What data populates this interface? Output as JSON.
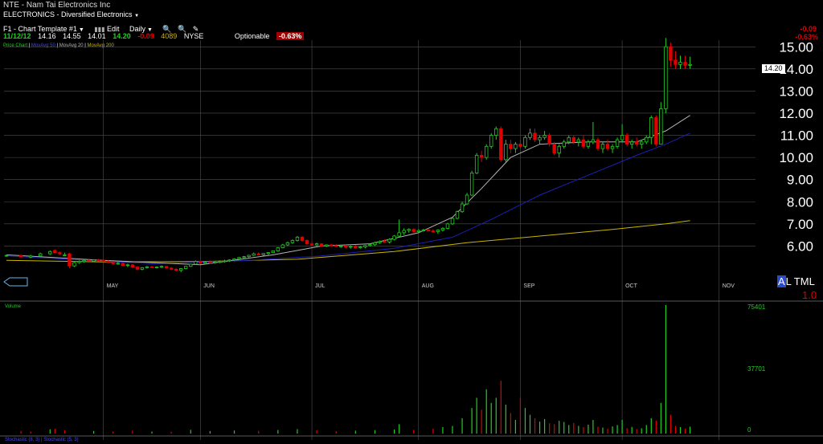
{
  "header": {
    "ticker": "NTE",
    "separator": "-",
    "name": "Nam Tai Electronics Inc",
    "sector": "ELECTRONICS - Diversified Electronics"
  },
  "toolbar": {
    "template": "F1 - Chart Template #1",
    "edit": "Edit",
    "period": "Daily"
  },
  "quote": {
    "date": "11/12/12",
    "open": "14.16",
    "high": "14.55",
    "low": "14.01",
    "last": "14.20",
    "change": "-0.09",
    "volume": "4089",
    "exchange": "NYSE",
    "optionable": "Optionable",
    "change_pct": "-0.63%"
  },
  "legend": {
    "price_chart": "Price Chart",
    "ma1": "MovAvg 50",
    "ma2": "MovAvg 20",
    "ma3": "MovAvg 200"
  },
  "corner": {
    "change": "-0.09",
    "change_pct": "-0.63%",
    "price_tag": "14.20",
    "mode_letter": "A",
    "mode_rest": "L TML",
    "scale": "1.0"
  },
  "volume_panel": {
    "label": "Volume",
    "max_label": "75401",
    "mid_label": "37701",
    "zero_label": "0"
  },
  "stoch_label": "Stochastic (8, 3) | Stochastic (5, 3)",
  "colors": {
    "up": "#22cc22",
    "down": "#e00000",
    "ma50": "#1e1eb4",
    "ma20": "#b4b4b4",
    "ma200": "#c8b400",
    "grid": "#505050",
    "volume_up": "#22cc22",
    "volume_down": "#e00000"
  },
  "chart_data": {
    "type": "candlestick",
    "y_ticks": [
      "6.00",
      "7.00",
      "8.00",
      "9.00",
      "10.00",
      "11.00",
      "12.00",
      "13.00",
      "14.00",
      "15.00"
    ],
    "ylim": [
      4.6,
      15.3
    ],
    "month_labels": [
      "MAY",
      "JUN",
      "JUL",
      "AUG",
      "SEP",
      "OCT",
      "NOV"
    ],
    "month_positions": [
      20,
      40,
      63,
      85,
      106,
      127,
      147
    ],
    "n_days": 155,
    "candles": [
      [
        0,
        5.55,
        5.6,
        5.5,
        5.58
      ],
      [
        3,
        5.58,
        5.62,
        5.5,
        5.5
      ],
      [
        5,
        5.5,
        5.6,
        5.45,
        5.55
      ],
      [
        7,
        5.55,
        5.7,
        5.5,
        5.65
      ],
      [
        9,
        5.65,
        5.8,
        5.6,
        5.75
      ],
      [
        10,
        5.8,
        5.85,
        5.7,
        5.7
      ],
      [
        11,
        5.7,
        5.75,
        5.6,
        5.65
      ],
      [
        12,
        5.6,
        5.7,
        5.55,
        5.6
      ],
      [
        13,
        5.65,
        5.7,
        5.0,
        5.1
      ],
      [
        14,
        5.1,
        5.3,
        5.05,
        5.25
      ],
      [
        15,
        5.25,
        5.35,
        5.2,
        5.3
      ],
      [
        16,
        5.3,
        5.4,
        5.25,
        5.35
      ],
      [
        17,
        5.35,
        5.4,
        5.3,
        5.32
      ],
      [
        18,
        5.32,
        5.4,
        5.28,
        5.38
      ],
      [
        19,
        5.38,
        5.42,
        5.3,
        5.35
      ],
      [
        20,
        5.35,
        5.4,
        5.28,
        5.3
      ],
      [
        21,
        5.3,
        5.36,
        5.22,
        5.25
      ],
      [
        22,
        5.25,
        5.3,
        5.18,
        5.2
      ],
      [
        23,
        5.2,
        5.28,
        5.15,
        5.22
      ],
      [
        24,
        5.22,
        5.25,
        5.1,
        5.12
      ],
      [
        25,
        5.12,
        5.2,
        5.05,
        5.15
      ],
      [
        26,
        5.15,
        5.18,
        5.0,
        5.05
      ],
      [
        27,
        5.05,
        5.1,
        4.9,
        4.95
      ],
      [
        28,
        4.95,
        5.05,
        4.9,
        5.02
      ],
      [
        29,
        5.02,
        5.1,
        4.98,
        5.06
      ],
      [
        30,
        5.06,
        5.1,
        5.0,
        5.03
      ],
      [
        31,
        5.03,
        5.08,
        4.98,
        5.05
      ],
      [
        32,
        5.05,
        5.12,
        5.0,
        5.08
      ],
      [
        33,
        5.08,
        5.1,
        4.98,
        5.0
      ],
      [
        34,
        5.0,
        5.05,
        4.9,
        4.95
      ],
      [
        35,
        4.95,
        5.0,
        4.85,
        4.9
      ],
      [
        36,
        4.9,
        5.0,
        4.82,
        4.98
      ],
      [
        37,
        4.98,
        5.1,
        4.95,
        5.08
      ],
      [
        38,
        5.08,
        5.2,
        5.05,
        5.18
      ],
      [
        39,
        5.18,
        5.35,
        5.15,
        5.3
      ],
      [
        40,
        5.3,
        5.35,
        5.2,
        5.22
      ],
      [
        41,
        5.22,
        5.3,
        5.18,
        5.27
      ],
      [
        42,
        5.27,
        5.35,
        5.2,
        5.25
      ],
      [
        43,
        5.25,
        5.32,
        5.2,
        5.28
      ],
      [
        44,
        5.28,
        5.35,
        5.22,
        5.3
      ],
      [
        45,
        5.3,
        5.38,
        5.25,
        5.33
      ],
      [
        46,
        5.33,
        5.4,
        5.28,
        5.37
      ],
      [
        47,
        5.37,
        5.45,
        5.32,
        5.42
      ],
      [
        48,
        5.42,
        5.5,
        5.38,
        5.48
      ],
      [
        49,
        5.48,
        5.55,
        5.42,
        5.52
      ],
      [
        50,
        5.52,
        5.6,
        5.48,
        5.58
      ],
      [
        51,
        5.58,
        5.7,
        5.55,
        5.65
      ],
      [
        52,
        5.65,
        5.72,
        5.58,
        5.6
      ],
      [
        53,
        5.6,
        5.68,
        5.55,
        5.66
      ],
      [
        54,
        5.66,
        5.72,
        5.6,
        5.7
      ],
      [
        55,
        5.7,
        5.8,
        5.68,
        5.78
      ],
      [
        56,
        5.78,
        5.95,
        5.75,
        5.92
      ],
      [
        57,
        5.92,
        6.1,
        5.9,
        6.05
      ],
      [
        58,
        6.05,
        6.2,
        6.0,
        6.15
      ],
      [
        59,
        6.15,
        6.3,
        6.1,
        6.25
      ],
      [
        60,
        6.25,
        6.45,
        6.2,
        6.4
      ],
      [
        61,
        6.4,
        6.45,
        6.2,
        6.25
      ],
      [
        62,
        6.25,
        6.3,
        6.05,
        6.1
      ],
      [
        63,
        6.1,
        6.2,
        6.0,
        6.05
      ],
      [
        64,
        6.05,
        6.15,
        6.0,
        6.1
      ],
      [
        65,
        6.1,
        6.12,
        5.98,
        6.0
      ],
      [
        66,
        6.0,
        6.08,
        5.95,
        6.05
      ],
      [
        67,
        6.05,
        6.1,
        5.98,
        6.02
      ],
      [
        68,
        6.02,
        6.08,
        5.95,
        5.98
      ],
      [
        69,
        5.98,
        6.05,
        5.92,
        6.0
      ],
      [
        70,
        6.0,
        6.05,
        5.9,
        5.95
      ],
      [
        71,
        5.95,
        6.02,
        5.88,
        5.98
      ],
      [
        72,
        5.98,
        6.05,
        5.9,
        5.92
      ],
      [
        73,
        5.92,
        6.0,
        5.88,
        5.96
      ],
      [
        74,
        5.96,
        6.05,
        5.9,
        6.02
      ],
      [
        75,
        6.02,
        6.1,
        5.98,
        6.06
      ],
      [
        76,
        6.06,
        6.2,
        6.0,
        6.15
      ],
      [
        77,
        6.15,
        6.25,
        6.1,
        6.2
      ],
      [
        78,
        6.2,
        6.3,
        6.15,
        6.18
      ],
      [
        79,
        6.18,
        6.35,
        6.12,
        6.3
      ],
      [
        80,
        6.3,
        6.5,
        6.25,
        6.45
      ],
      [
        81,
        6.45,
        7.2,
        6.4,
        6.6
      ],
      [
        82,
        6.6,
        6.8,
        6.5,
        6.7
      ],
      [
        83,
        6.7,
        6.8,
        6.6,
        6.75
      ],
      [
        84,
        6.75,
        6.8,
        6.6,
        6.65
      ],
      [
        85,
        6.65,
        6.75,
        6.6,
        6.7
      ],
      [
        86,
        6.7,
        6.78,
        6.65,
        6.72
      ],
      [
        87,
        6.72,
        6.78,
        6.65,
        6.68
      ],
      [
        88,
        6.68,
        6.75,
        6.6,
        6.65
      ],
      [
        89,
        6.65,
        6.75,
        6.55,
        6.72
      ],
      [
        90,
        6.72,
        6.85,
        6.65,
        6.8
      ],
      [
        91,
        6.8,
        7.05,
        6.75,
        7.0
      ],
      [
        92,
        7.0,
        7.3,
        6.95,
        7.25
      ],
      [
        93,
        7.25,
        7.6,
        7.2,
        7.55
      ],
      [
        94,
        7.55,
        8.0,
        7.5,
        7.9
      ],
      [
        95,
        7.9,
        8.4,
        7.85,
        8.3
      ],
      [
        96,
        8.3,
        9.4,
        8.25,
        9.3
      ],
      [
        97,
        9.3,
        10.2,
        9.25,
        10.1
      ],
      [
        98,
        10.1,
        10.3,
        9.8,
        10.0
      ],
      [
        99,
        10.0,
        10.6,
        9.9,
        10.5
      ],
      [
        100,
        10.5,
        11.1,
        10.4,
        11.0
      ],
      [
        101,
        11.0,
        11.4,
        10.8,
        11.3
      ],
      [
        102,
        11.3,
        11.4,
        9.8,
        9.9
      ],
      [
        103,
        9.9,
        10.8,
        9.8,
        10.6
      ],
      [
        104,
        10.6,
        10.8,
        10.2,
        10.4
      ],
      [
        105,
        10.4,
        10.7,
        10.2,
        10.6
      ],
      [
        106,
        10.6,
        10.8,
        10.4,
        10.5
      ],
      [
        107,
        10.5,
        11.0,
        10.4,
        10.9
      ],
      [
        108,
        10.9,
        11.3,
        10.8,
        11.1
      ],
      [
        109,
        11.1,
        11.3,
        10.7,
        10.8
      ],
      [
        110,
        10.8,
        11.0,
        10.6,
        10.9
      ],
      [
        111,
        10.9,
        11.2,
        10.8,
        11.0
      ],
      [
        112,
        11.0,
        11.1,
        10.5,
        10.6
      ],
      [
        113,
        10.6,
        10.7,
        10.1,
        10.2
      ],
      [
        114,
        10.2,
        10.6,
        10.0,
        10.5
      ],
      [
        115,
        10.5,
        10.8,
        10.4,
        10.7
      ],
      [
        116,
        10.7,
        11.0,
        10.6,
        10.9
      ],
      [
        117,
        10.9,
        11.0,
        10.6,
        10.7
      ],
      [
        118,
        10.7,
        10.9,
        10.5,
        10.8
      ],
      [
        119,
        10.8,
        11.0,
        10.4,
        10.5
      ],
      [
        120,
        10.5,
        10.8,
        10.4,
        10.7
      ],
      [
        121,
        10.7,
        11.6,
        10.6,
        10.8
      ],
      [
        122,
        10.8,
        10.9,
        10.3,
        10.4
      ],
      [
        123,
        10.4,
        10.7,
        10.2,
        10.6
      ],
      [
        124,
        10.6,
        10.8,
        10.3,
        10.4
      ],
      [
        125,
        10.4,
        10.6,
        10.2,
        10.5
      ],
      [
        126,
        10.5,
        10.9,
        10.4,
        10.8
      ],
      [
        127,
        10.8,
        11.5,
        10.7,
        11.0
      ],
      [
        128,
        11.0,
        11.1,
        10.5,
        10.6
      ],
      [
        129,
        10.6,
        10.8,
        10.4,
        10.7
      ],
      [
        130,
        10.7,
        10.9,
        10.5,
        10.6
      ],
      [
        131,
        10.6,
        10.8,
        10.4,
        10.7
      ],
      [
        132,
        10.7,
        11.0,
        10.6,
        10.9
      ],
      [
        133,
        10.9,
        11.9,
        10.6,
        11.8
      ],
      [
        134,
        11.8,
        11.9,
        10.5,
        10.6
      ],
      [
        135,
        10.6,
        12.5,
        10.6,
        12.2
      ],
      [
        136,
        12.2,
        15.4,
        12.0,
        15.0
      ],
      [
        137,
        15.0,
        15.2,
        14.1,
        14.4
      ],
      [
        138,
        14.4,
        14.8,
        14.0,
        14.2
      ],
      [
        139,
        14.2,
        14.6,
        14.0,
        14.3
      ],
      [
        140,
        14.3,
        14.6,
        14.0,
        14.16
      ],
      [
        141,
        14.16,
        14.55,
        14.01,
        14.2
      ]
    ],
    "ma20": [
      [
        0,
        5.6
      ],
      [
        20,
        5.35
      ],
      [
        40,
        5.15
      ],
      [
        55,
        5.6
      ],
      [
        65,
        6.0
      ],
      [
        75,
        6.1
      ],
      [
        85,
        6.6
      ],
      [
        92,
        7.3
      ],
      [
        98,
        8.6
      ],
      [
        104,
        10.0
      ],
      [
        110,
        10.6
      ],
      [
        120,
        10.7
      ],
      [
        130,
        10.7
      ],
      [
        136,
        11.2
      ],
      [
        141,
        11.9
      ]
    ],
    "ma50": [
      [
        0,
        5.55
      ],
      [
        30,
        5.2
      ],
      [
        50,
        5.35
      ],
      [
        65,
        5.55
      ],
      [
        80,
        5.9
      ],
      [
        92,
        6.4
      ],
      [
        100,
        7.2
      ],
      [
        110,
        8.3
      ],
      [
        120,
        9.2
      ],
      [
        130,
        10.1
      ],
      [
        136,
        10.6
      ],
      [
        141,
        11.1
      ]
    ],
    "ma200": [
      [
        0,
        5.35
      ],
      [
        20,
        5.28
      ],
      [
        40,
        5.3
      ],
      [
        60,
        5.4
      ],
      [
        80,
        5.75
      ],
      [
        95,
        6.15
      ],
      [
        110,
        6.45
      ],
      [
        125,
        6.75
      ],
      [
        136,
        7.0
      ],
      [
        141,
        7.15
      ]
    ],
    "volume_max": 75401,
    "volume": [
      [
        3,
        1500,
        0
      ],
      [
        5,
        1200,
        0
      ],
      [
        9,
        2500,
        1
      ],
      [
        10,
        2800,
        0
      ],
      [
        12,
        1800,
        0
      ],
      [
        18,
        1500,
        1
      ],
      [
        22,
        1300,
        0
      ],
      [
        26,
        1700,
        0
      ],
      [
        30,
        1200,
        1
      ],
      [
        34,
        1100,
        0
      ],
      [
        38,
        2200,
        1
      ],
      [
        42,
        1500,
        1
      ],
      [
        47,
        1800,
        1
      ],
      [
        52,
        1600,
        0
      ],
      [
        56,
        2100,
        1
      ],
      [
        60,
        2600,
        1
      ],
      [
        64,
        1900,
        0
      ],
      [
        68,
        1400,
        0
      ],
      [
        72,
        1700,
        1
      ],
      [
        76,
        2000,
        1
      ],
      [
        80,
        2400,
        1
      ],
      [
        81,
        5500,
        1
      ],
      [
        84,
        2200,
        0
      ],
      [
        88,
        2800,
        0
      ],
      [
        90,
        3800,
        1
      ],
      [
        92,
        4500,
        1
      ],
      [
        94,
        9000,
        1
      ],
      [
        96,
        15000,
        1
      ],
      [
        97,
        21000,
        1
      ],
      [
        98,
        14000,
        0
      ],
      [
        99,
        26000,
        1
      ],
      [
        100,
        18000,
        1
      ],
      [
        101,
        21000,
        1
      ],
      [
        102,
        31000,
        0
      ],
      [
        103,
        17000,
        1
      ],
      [
        104,
        12000,
        0
      ],
      [
        105,
        8000,
        1
      ],
      [
        106,
        21000,
        0
      ],
      [
        107,
        15000,
        1
      ],
      [
        108,
        11000,
        1
      ],
      [
        109,
        9000,
        0
      ],
      [
        110,
        7000,
        1
      ],
      [
        111,
        8500,
        1
      ],
      [
        112,
        6000,
        0
      ],
      [
        113,
        5500,
        0
      ],
      [
        114,
        7500,
        1
      ],
      [
        115,
        6800,
        1
      ],
      [
        116,
        5000,
        1
      ],
      [
        117,
        6200,
        0
      ],
      [
        118,
        4500,
        1
      ],
      [
        119,
        3800,
        0
      ],
      [
        120,
        5200,
        1
      ],
      [
        121,
        8000,
        1
      ],
      [
        122,
        4000,
        0
      ],
      [
        123,
        3500,
        1
      ],
      [
        124,
        2800,
        0
      ],
      [
        125,
        4200,
        1
      ],
      [
        126,
        5000,
        1
      ],
      [
        127,
        8000,
        1
      ],
      [
        128,
        3200,
        0
      ],
      [
        129,
        3900,
        1
      ],
      [
        130,
        2600,
        0
      ],
      [
        131,
        3100,
        1
      ],
      [
        132,
        5000,
        1
      ],
      [
        133,
        9000,
        1
      ],
      [
        134,
        7500,
        0
      ],
      [
        135,
        18000,
        1
      ],
      [
        136,
        75401,
        1
      ],
      [
        137,
        11000,
        0
      ],
      [
        138,
        4500,
        0
      ],
      [
        139,
        3800,
        1
      ],
      [
        140,
        2900,
        0
      ],
      [
        141,
        4089,
        1
      ]
    ],
    "volume_ticks": [
      "75401",
      "37701",
      "0"
    ]
  }
}
